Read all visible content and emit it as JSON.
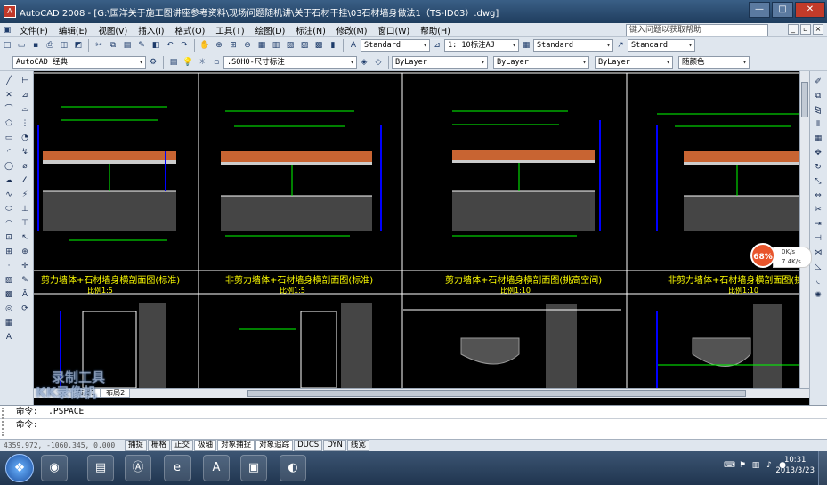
{
  "window": {
    "title": "AutoCAD 2008 - [G:\\国洋关于施工图讲座参考资料\\现场问题随机讲\\关于石材干挂\\03石材墙身做法1（TS-ID03）.dwg]",
    "app_icon_label": "A",
    "minimize_glyph": "—",
    "maximize_glyph": "□",
    "close_glyph": "✕"
  },
  "menu": {
    "items": [
      "文件(F)",
      "编辑(E)",
      "视图(V)",
      "插入(I)",
      "格式(O)",
      "工具(T)",
      "绘图(D)",
      "标注(N)",
      "修改(M)",
      "窗口(W)",
      "帮助(H)"
    ],
    "help_search_placeholder": "键入问题以获取帮助"
  },
  "toolbar1": {
    "text_style": "Standard",
    "dim_style": "1: 10标注AJ",
    "table_style": "Standard",
    "multileader_style": "Standard"
  },
  "toolbar2": {
    "workspace": "AutoCAD 经典",
    "layer": ".SOHO-尺寸标注",
    "color": "ByLayer",
    "linetype": "ByLayer",
    "lineweight": "ByLayer",
    "plotstyle": "随颜色"
  },
  "drawing": {
    "section_titles": [
      "剪力墙体+石材墙身横剖面图(标准)",
      "非剪力墙体+石材墙身横剖面图(标准)",
      "剪力墙体+石材墙身横剖面图(挑高空间)",
      "非剪力墙体+石材墙身横剖面图(挑"
    ],
    "scale_labels": [
      "比例1:5",
      "比例1:5",
      "比例1:10",
      "比例1:10"
    ]
  },
  "layout_tabs": [
    "布局1",
    "布局2"
  ],
  "watermark": {
    "line1": "录制工具",
    "line2": "KK录像机"
  },
  "overlay": {
    "progress_percent": "68%",
    "speed_up": "0K/s",
    "speed_down": "7.4K/s"
  },
  "command": {
    "history": "命令:  _.PSPACE",
    "prompt": "命令:"
  },
  "status": {
    "coords": "4359.972, -1060.345, 0.000",
    "buttons": [
      "捕捉",
      "栅格",
      "正交",
      "极轴",
      "对象捕捉",
      "对象追踪",
      "DUCS",
      "DYN",
      "线宽"
    ],
    "active_buttons": [
      "极轴",
      "对象捕捉",
      "对象追踪"
    ]
  },
  "taskbar": {
    "start_glyph": "❖",
    "clock_time": "10:31",
    "clock_date": "2013/3/23"
  },
  "colors": {
    "canvas": "#000000",
    "frame_line": "#ffffff",
    "section_title": "#ffff00",
    "hatch": "#8a8a8a",
    "green_lines": "#00ff00",
    "blue_dims": "#0000ff",
    "stone": "#c86432"
  },
  "icons": {
    "left_palette": [
      "line-icon",
      "xline-icon",
      "polyline-icon",
      "polygon-icon",
      "rectangle-icon",
      "arc-icon",
      "circle-icon",
      "revcloud-icon",
      "spline-icon",
      "ellipse-icon",
      "ellipse-arc-icon",
      "insert-block-icon",
      "make-block-icon",
      "point-icon",
      "hatch-icon",
      "gradient-icon",
      "region-icon",
      "table-icon",
      "mtext-icon"
    ],
    "right_palette": [
      "erase-icon",
      "copy-icon",
      "mirror-icon",
      "offset-icon",
      "array-icon",
      "move-icon",
      "rotate-icon",
      "scale-icon",
      "stretch-icon",
      "trim-icon",
      "extend-icon",
      "break-icon",
      "join-icon",
      "chamfer-icon",
      "fillet-icon",
      "explode-icon"
    ]
  }
}
